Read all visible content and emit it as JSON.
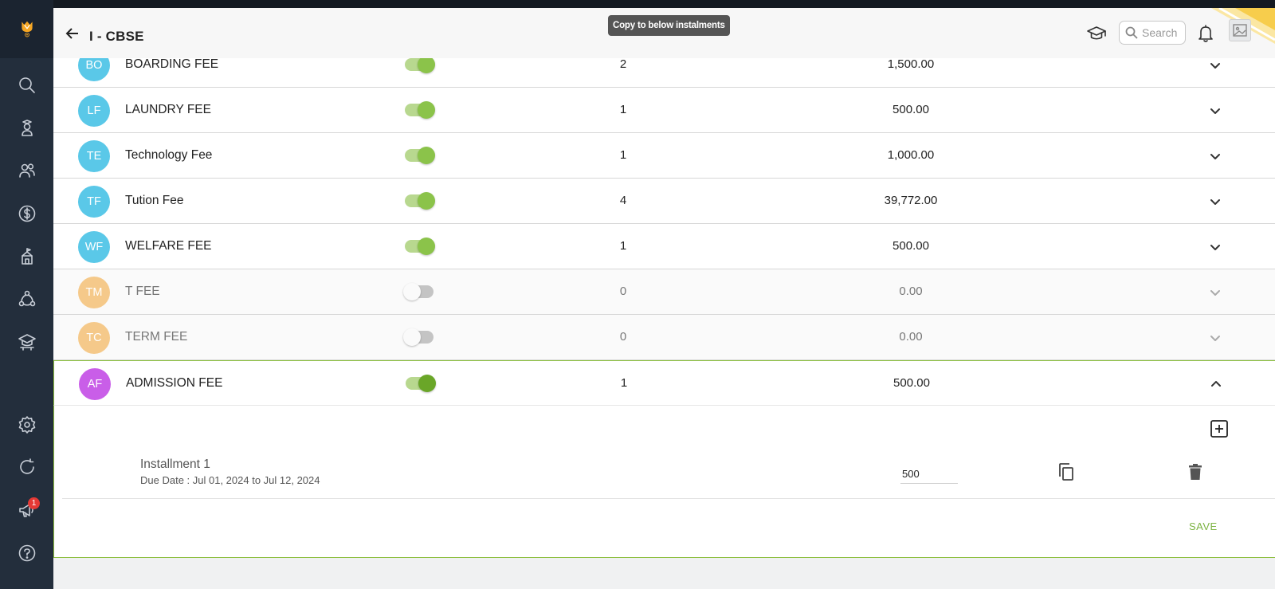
{
  "header": {
    "title": "I - CBSE",
    "tooltip": "Copy to below instalments",
    "search_placeholder": "Search"
  },
  "sidebar": {
    "notification_count": "1",
    "icons": [
      "search-icon",
      "student-icon",
      "users-icon",
      "dollar-icon",
      "school-icon",
      "network-icon",
      "classroom-icon",
      "settings-icon",
      "refresh-icon",
      "megaphone-icon",
      "help-icon"
    ]
  },
  "fees": [
    {
      "initials": "BO",
      "name": "BOARDING FEE",
      "enabled": true,
      "count": "2",
      "amount": "1,500.00",
      "color": "#5ac8e8"
    },
    {
      "initials": "LF",
      "name": "LAUNDRY FEE",
      "enabled": true,
      "count": "1",
      "amount": "500.00",
      "color": "#5ac8e8"
    },
    {
      "initials": "TE",
      "name": "Technology Fee",
      "enabled": true,
      "count": "1",
      "amount": "1,000.00",
      "color": "#5ac8e8"
    },
    {
      "initials": "TF",
      "name": "Tution Fee",
      "enabled": true,
      "count": "4",
      "amount": "39,772.00",
      "color": "#5ac8e8"
    },
    {
      "initials": "WF",
      "name": "WELFARE FEE",
      "enabled": true,
      "count": "1",
      "amount": "500.00",
      "color": "#5ac8e8"
    },
    {
      "initials": "TM",
      "name": "T FEE",
      "enabled": false,
      "count": "0",
      "amount": "0.00",
      "color": "#f5c98a"
    },
    {
      "initials": "TC",
      "name": "TERM FEE",
      "enabled": false,
      "count": "0",
      "amount": "0.00",
      "color": "#f5c98a"
    },
    {
      "initials": "AF",
      "name": "ADMISSION FEE",
      "enabled": true,
      "count": "1",
      "amount": "500.00",
      "color": "#c95ee8"
    }
  ],
  "installment": {
    "title": "Installment 1",
    "due": "Due Date : Jul 01, 2024 to Jul 12, 2024",
    "amount": "500"
  },
  "save_label": "SAVE"
}
